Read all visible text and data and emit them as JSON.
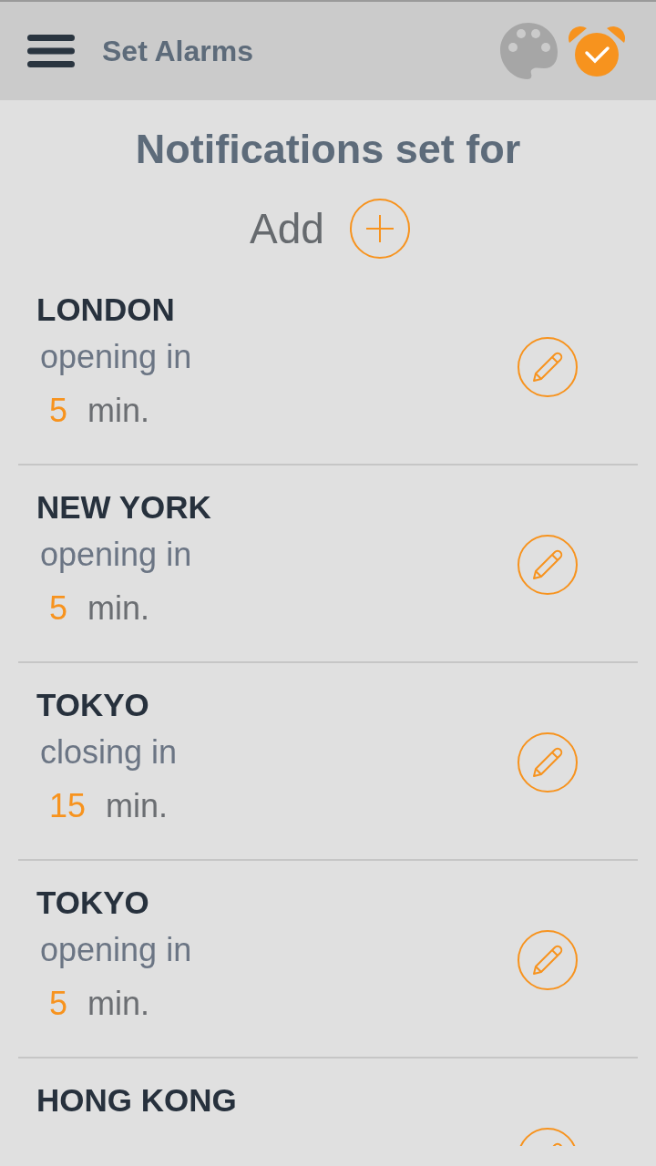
{
  "app_bar": {
    "title": "Set Alarms"
  },
  "heading": "Notifications set for",
  "add_label": "Add",
  "alarms": [
    {
      "market": "LONDON",
      "event": "opening in",
      "minutes": "5",
      "unit": "min."
    },
    {
      "market": "NEW YORK",
      "event": "opening in",
      "minutes": "5",
      "unit": "min."
    },
    {
      "market": "TOKYO",
      "event": "closing in",
      "minutes": "15",
      "unit": "min."
    },
    {
      "market": "TOKYO",
      "event": "opening in",
      "minutes": "5",
      "unit": "min."
    },
    {
      "market": "HONG KONG"
    }
  ]
}
